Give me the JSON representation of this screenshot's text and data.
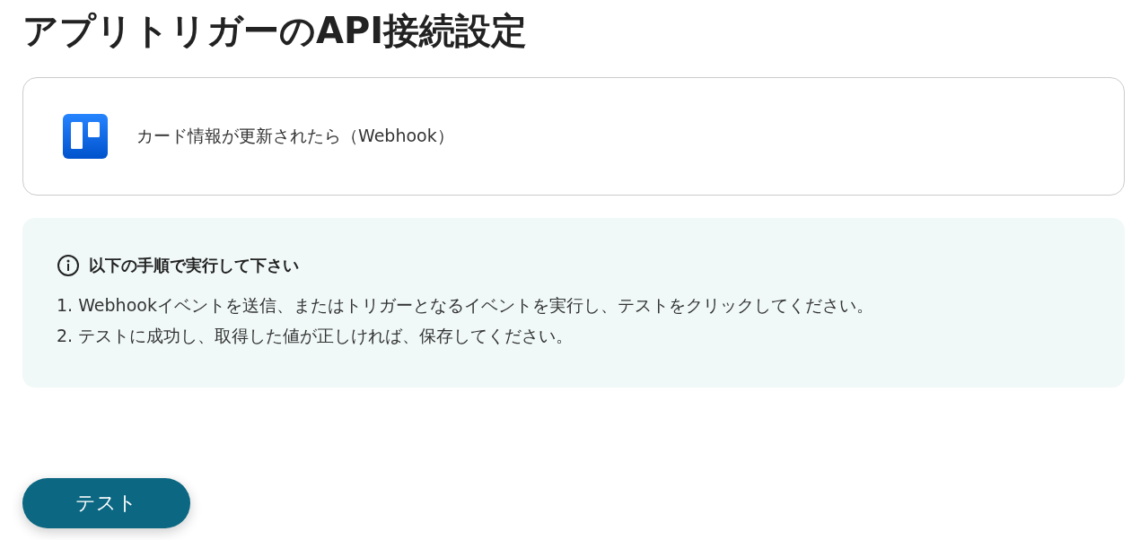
{
  "title": "アプリトリガーのAPI接続設定",
  "trigger": {
    "label": "カード情報が更新されたら（Webhook）"
  },
  "instructions": {
    "heading": "以下の手順で実行して下さい",
    "steps": [
      "1. Webhookイベントを送信、またはトリガーとなるイベントを実行し、テストをクリックしてください。",
      "2. テストに成功し、取得した値が正しければ、保存してください。"
    ]
  },
  "button": {
    "label": "テスト"
  }
}
